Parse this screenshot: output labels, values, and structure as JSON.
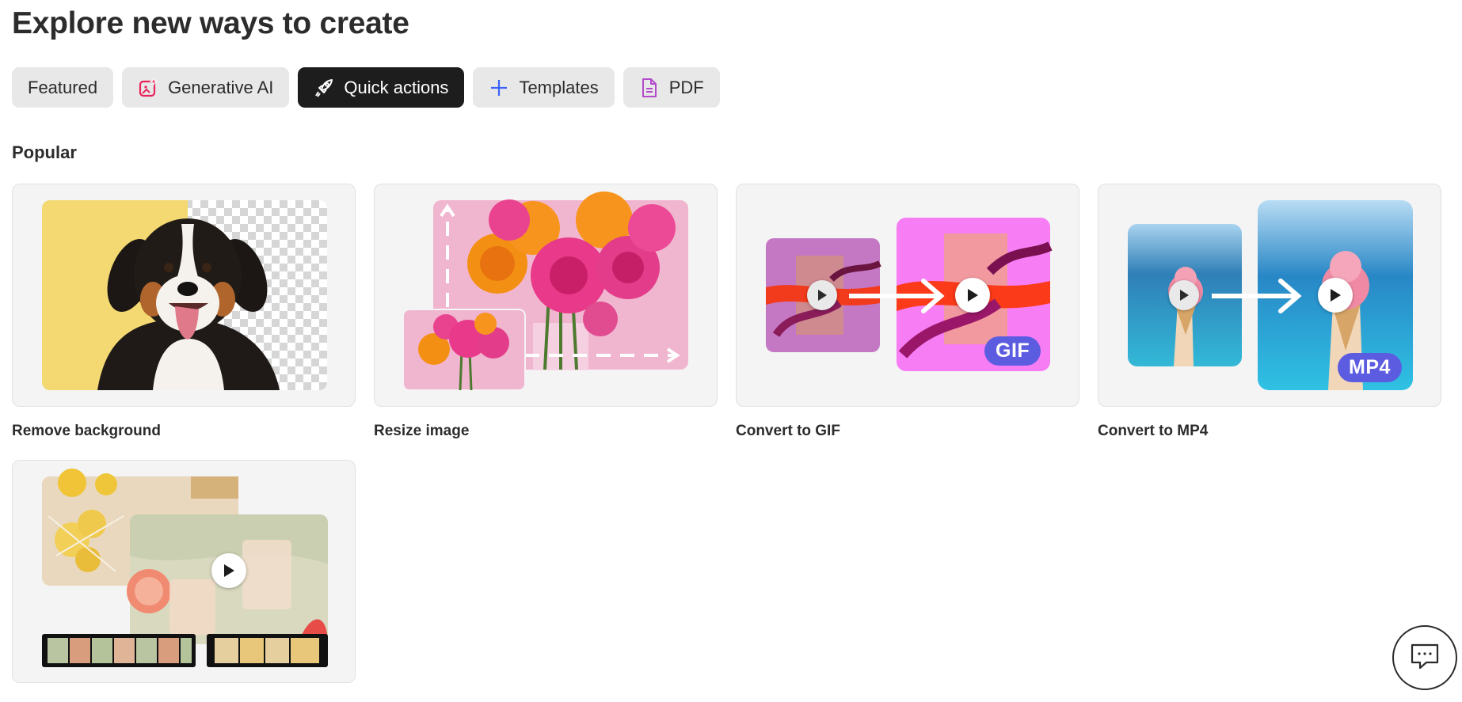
{
  "page": {
    "title": "Explore new ways to create"
  },
  "tabs": [
    {
      "label": "Featured",
      "icon": "",
      "active": false
    },
    {
      "label": "Generative AI",
      "icon": "sparkle-image-icon",
      "active": false
    },
    {
      "label": "Quick actions",
      "icon": "rocket-icon",
      "active": true
    },
    {
      "label": "Templates",
      "icon": "plus-icon",
      "active": false
    },
    {
      "label": "PDF",
      "icon": "document-icon",
      "active": false
    }
  ],
  "section": {
    "title": "Popular"
  },
  "cards": [
    {
      "label": "Remove background"
    },
    {
      "label": "Resize image"
    },
    {
      "label": "Convert to GIF",
      "badge": "GIF"
    },
    {
      "label": "Convert to MP4",
      "badge": "MP4"
    },
    {
      "label": ""
    }
  ],
  "colors": {
    "active_tab": "#1d1d1d",
    "tab_bg": "#e8e8e8",
    "badge": "#5c5ce0",
    "gen_ai_icon": "#e8245a",
    "templates_icon": "#3b63fb",
    "pdf_icon": "#b34ac9"
  }
}
